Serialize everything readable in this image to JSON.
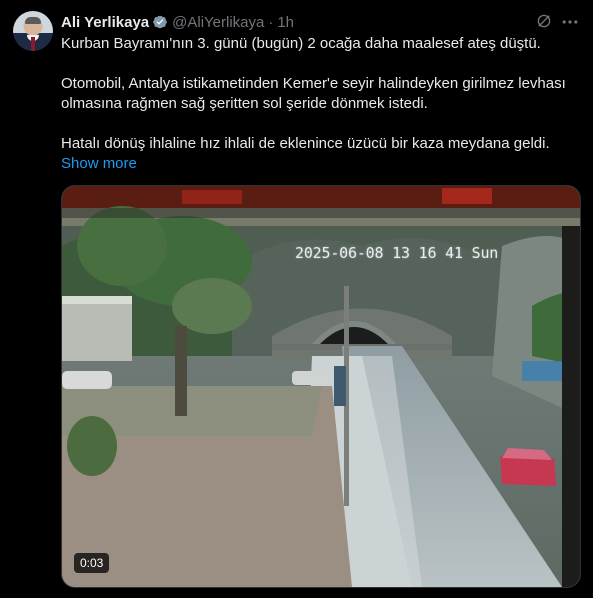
{
  "author": {
    "name": "Ali Yerlikaya",
    "handle": "@AliYerlikaya",
    "time": "1h",
    "separator": "·"
  },
  "tweet": {
    "line1": "Kurban Bayramı'nın 3. günü (bugün) 2 ocağa daha maalesef ateş düştü.",
    "line2": "Otomobil, Antalya istikametinden Kemer'e seyir halindeyken girilmez levhası",
    "line3": "olmasına rağmen sağ şeritten sol şeride dönmek istedi.",
    "line4": "Hatalı dönüş ihlaline hız ihlali de eklenince üzücü bir kaza meydana geldi.",
    "show_more": "Show more"
  },
  "video": {
    "overlay_timestamp": "2025-06-08 13 16 41 Sun",
    "duration": "0:03"
  },
  "colors": {
    "background": "#000000",
    "text": "#e7e9ea",
    "muted": "#71767b",
    "link": "#1d9bf0",
    "verified": "#829aab"
  },
  "icons": [
    "verified-badge-icon",
    "grok-icon",
    "more-icon"
  ]
}
